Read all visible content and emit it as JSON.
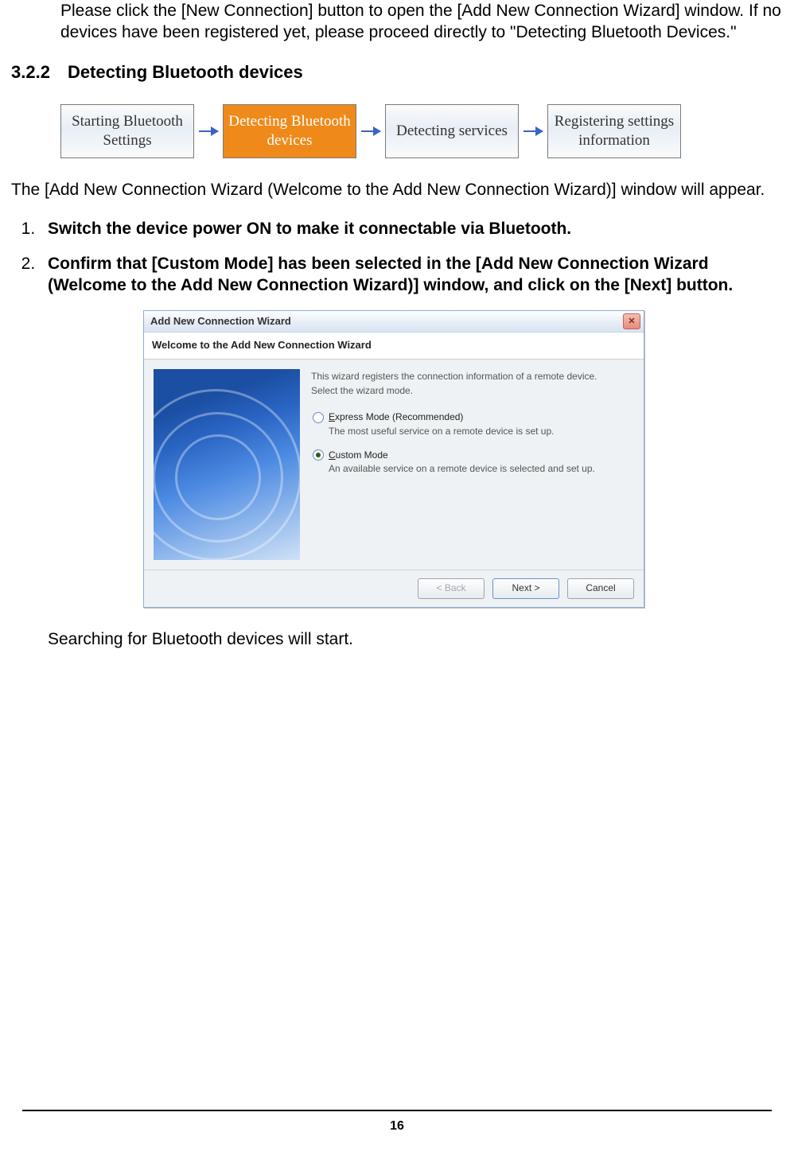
{
  "intro_text": "Please click the [New Connection] button to open the [Add New Connection Wizard] window. If no devices have been registered yet, please proceed directly to \"Detecting Bluetooth Devices.\"",
  "section_number": "3.2.2",
  "section_title": "Detecting Bluetooth devices",
  "flow": {
    "step1": "Starting Bluetooth Settings",
    "step2": "Detecting Bluetooth devices",
    "step3": "Detecting services",
    "step4": "Registering settings information"
  },
  "paragraph1": "The [Add New Connection Wizard (Welcome to the Add New Connection Wizard)] window will appear.",
  "steps": {
    "item1": "Switch the device power ON to make it connectable via Bluetooth.",
    "item2": "Confirm that [Custom Mode] has been selected in the [Add New Connection Wizard (Welcome to the Add New Connection Wizard)] window, and click on the [Next] button."
  },
  "wizard": {
    "title": "Add New Connection Wizard",
    "welcome": "Welcome to the Add New Connection Wizard",
    "desc1": "This wizard registers the connection information of a remote device.",
    "desc2": "Select the wizard mode.",
    "opt_express": "Express Mode (Recommended)",
    "opt_express_sub": "The most useful service on a remote device is set up.",
    "opt_custom": "Custom Mode",
    "opt_custom_sub": "An available service on a remote device is selected and set up.",
    "btn_back": "< Back",
    "btn_next": "Next >",
    "btn_cancel": "Cancel"
  },
  "after_note": "Searching for Bluetooth devices will start.",
  "page_number": "16"
}
